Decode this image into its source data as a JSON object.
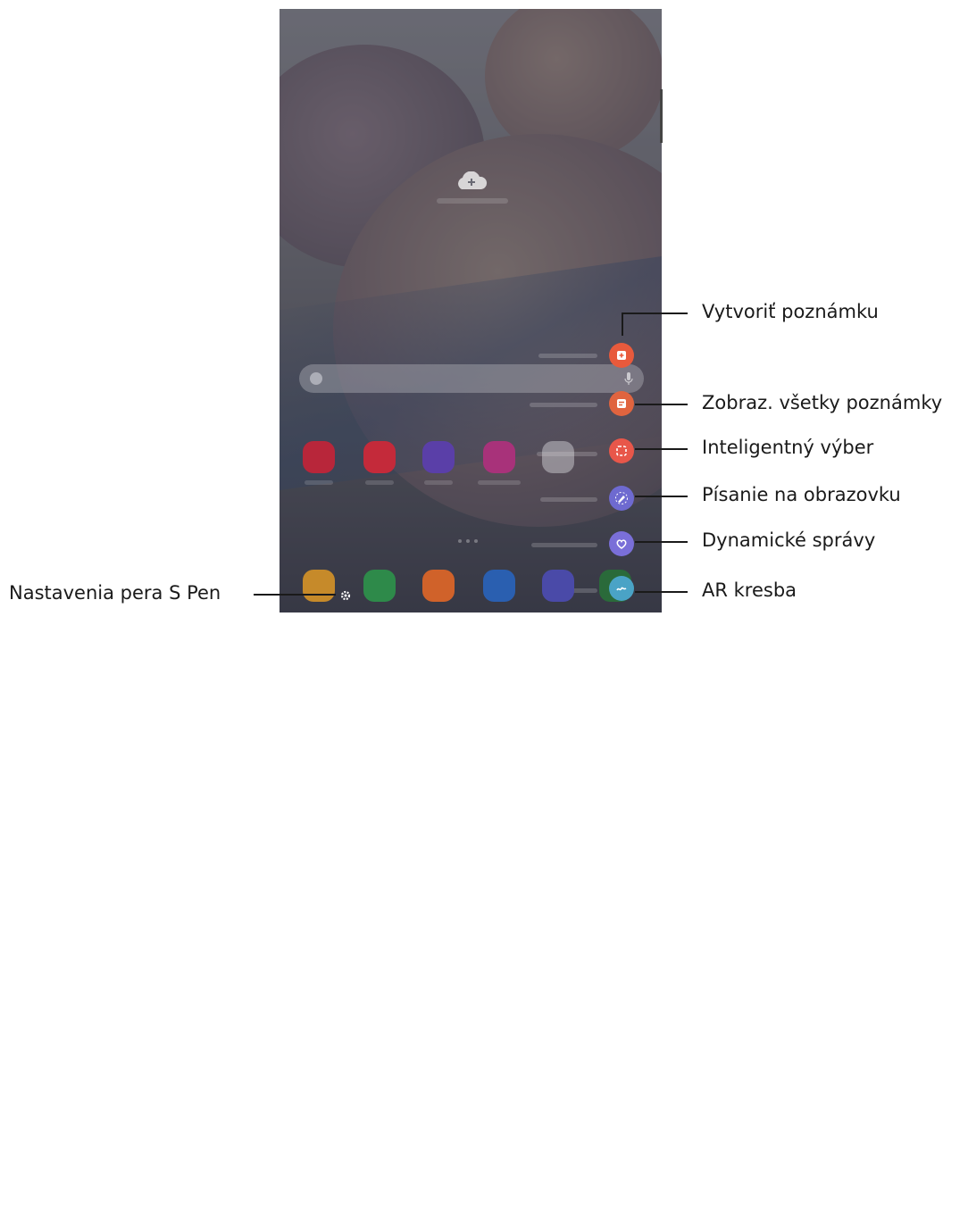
{
  "labels": {
    "create_note": "Vytvoriť poznámku",
    "view_all_notes": "Zobraz. všetky poznámky",
    "smart_select": "Inteligentný výber",
    "screen_write": "Písanie na obrazovku",
    "live_messages": "Dynamické správy",
    "ar_doodle": "AR kresba",
    "s_pen_settings": "Nastavenia pera S Pen"
  },
  "air_command_colors": {
    "create_note": "#e85a3c",
    "view_all_notes": "#e0643f",
    "smart_select": "#e8574a",
    "screen_write": "#6e6ad0",
    "live_messages": "#7a6fd8",
    "ar_doodle": "#4aa3c6"
  },
  "icons": {
    "create_note": "note-plus-icon",
    "view_all_notes": "notes-list-icon",
    "smart_select": "dashed-square-icon",
    "screen_write": "pen-write-icon",
    "live_messages": "heart-icon",
    "ar_doodle": "doodle-icon",
    "s_pen_settings": "gear-icon"
  }
}
